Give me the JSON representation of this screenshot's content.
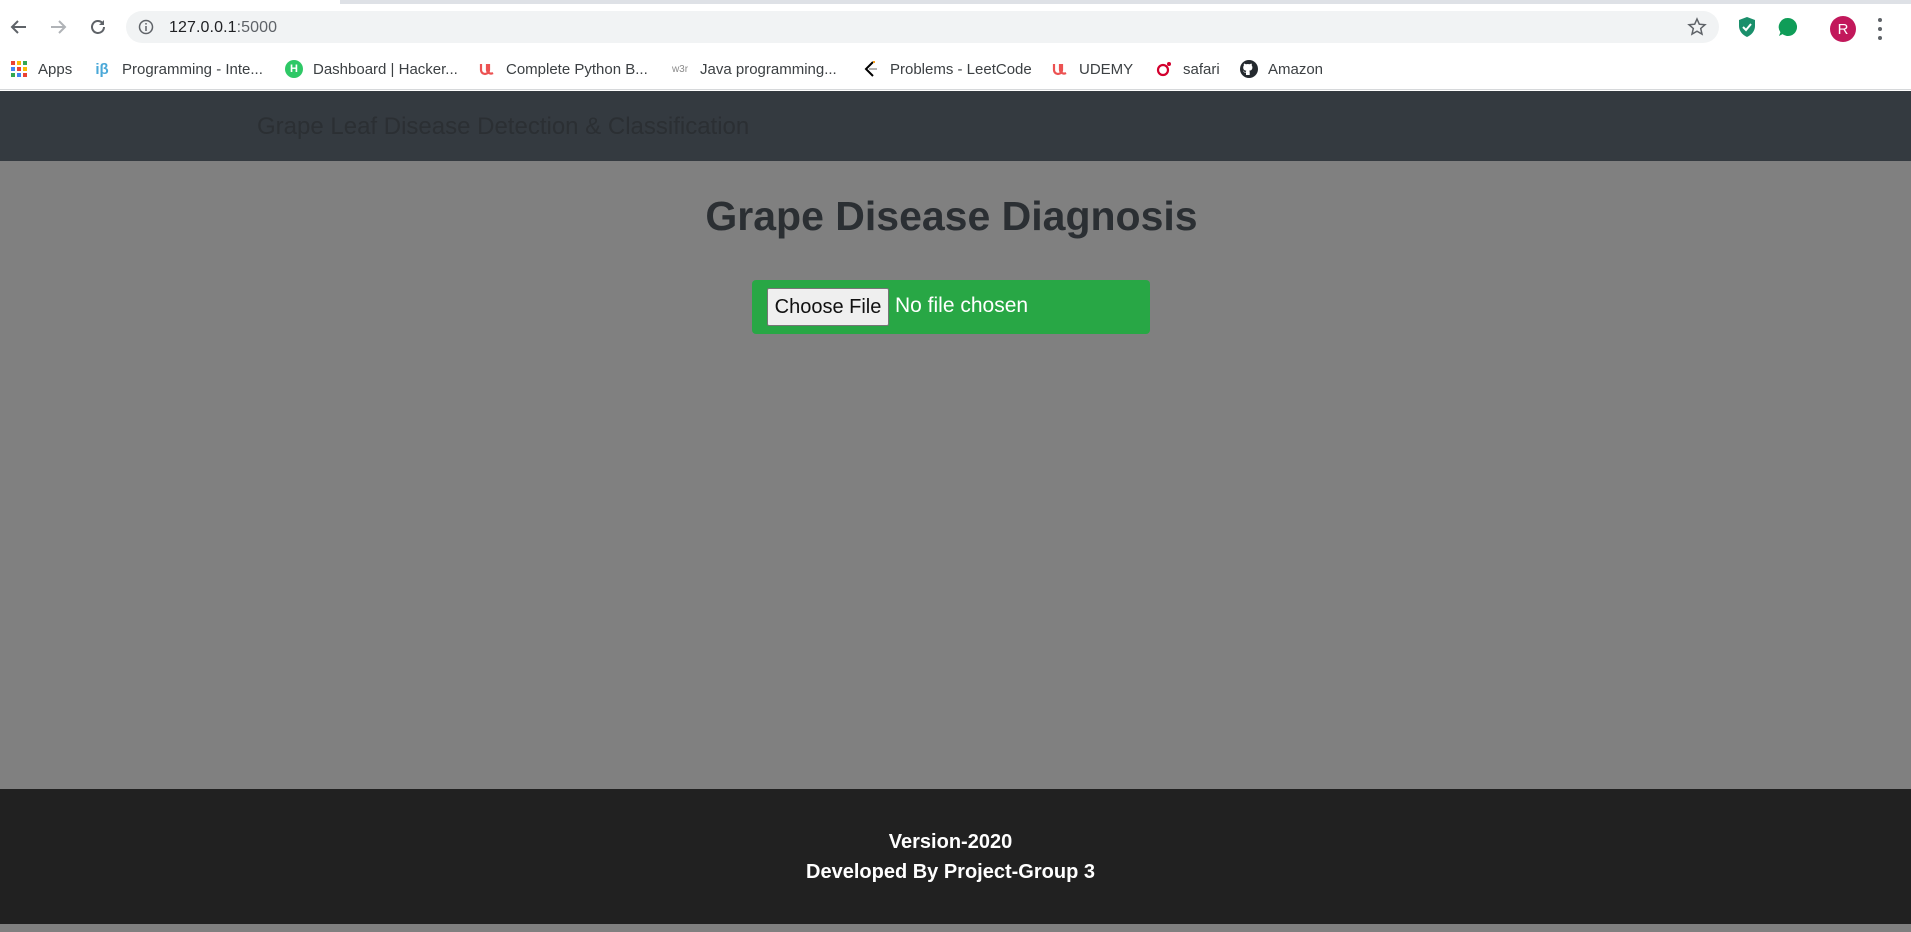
{
  "browser": {
    "url_host": "127.0.0.1",
    "url_port": ":5000",
    "avatar_initial": "R",
    "bookmarks": [
      {
        "label": "Apps",
        "icon": "apps-grid-icon"
      },
      {
        "label": "Programming - Inte...",
        "icon": "interviewbit-icon"
      },
      {
        "label": "Dashboard | Hacker...",
        "icon": "hackerrank-icon"
      },
      {
        "label": "Complete Python B...",
        "icon": "udemy-icon"
      },
      {
        "label": "Java programming...",
        "icon": "w3resource-icon"
      },
      {
        "label": "Problems - LeetCode",
        "icon": "leetcode-icon"
      },
      {
        "label": "UDEMY",
        "icon": "udemy-icon"
      },
      {
        "label": "safari",
        "icon": "oreilly-icon"
      },
      {
        "label": "Amazon",
        "icon": "github-icon"
      }
    ],
    "icon_labels": {
      "ib": "iβ",
      "hr": "H",
      "w3": "w3r"
    }
  },
  "page": {
    "brand": "Grape Leaf Disease Detection & Classification",
    "heading": "Grape Disease Diagnosis",
    "upload": {
      "button_label": "Choose File",
      "status": "No file chosen"
    },
    "footer": {
      "version": "Version-2020",
      "developer": "Developed By Project-Group 3"
    }
  },
  "colors": {
    "navbar": "#343a40",
    "main_bg": "#808080",
    "upload_bg": "#28a745",
    "footer_bg": "#212121",
    "avatar": "#c2185b"
  }
}
